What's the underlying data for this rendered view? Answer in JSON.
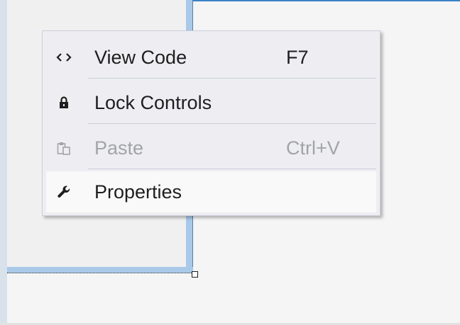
{
  "context_menu": {
    "items": [
      {
        "icon": "code-brackets-icon",
        "label": "View Code",
        "shortcut": "F7",
        "enabled": true,
        "highlighted": false
      },
      {
        "icon": "lock-icon",
        "label": "Lock Controls",
        "shortcut": "",
        "enabled": true,
        "highlighted": false
      },
      {
        "icon": "paste-icon",
        "label": "Paste",
        "shortcut": "Ctrl+V",
        "enabled": false,
        "highlighted": false
      },
      {
        "icon": "wrench-icon",
        "label": "Properties",
        "shortcut": "",
        "enabled": true,
        "highlighted": true
      }
    ]
  },
  "colors": {
    "menu_background": "#eeeef2",
    "menu_border": "#cccedb",
    "highlight_background": "#f9f9f9",
    "text": "#1e1e1e",
    "disabled_text": "#a2a4a5",
    "form_border": "#a9c9e8",
    "designer_background": "#f5f5f5"
  }
}
